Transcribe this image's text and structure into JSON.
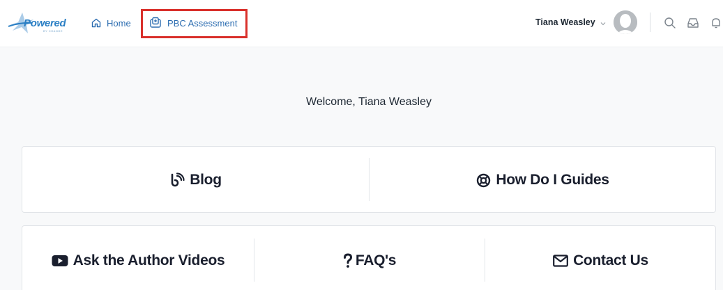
{
  "header": {
    "logo": {
      "text": "Powered",
      "tagline": "BY CHANGE"
    },
    "nav": [
      {
        "label": "Home",
        "icon": "home-icon"
      },
      {
        "label": "PBC Assessment",
        "icon": "assessment-icon"
      }
    ],
    "user": {
      "name": "Tiana Weasley",
      "dropdown_icon": "chevron-down-icon",
      "avatar": "avatar"
    },
    "actions": [
      "search-icon",
      "inbox-icon",
      "bell-icon"
    ]
  },
  "welcome": "Welcome, Tiana Weasley",
  "row1": [
    {
      "label": "Blog",
      "icon": "blog-icon"
    },
    {
      "label": "How Do I Guides",
      "icon": "lifebuoy-icon"
    }
  ],
  "row2": [
    {
      "label": "Ask the Author Videos",
      "icon": "youtube-icon"
    },
    {
      "label": "FAQ's",
      "icon": "question-icon"
    },
    {
      "label": "Contact Us",
      "icon": "envelope-icon"
    }
  ],
  "colors": {
    "accent": "#2b6cb0",
    "highlight": "#d9302b",
    "background": "#f8f9fa"
  }
}
